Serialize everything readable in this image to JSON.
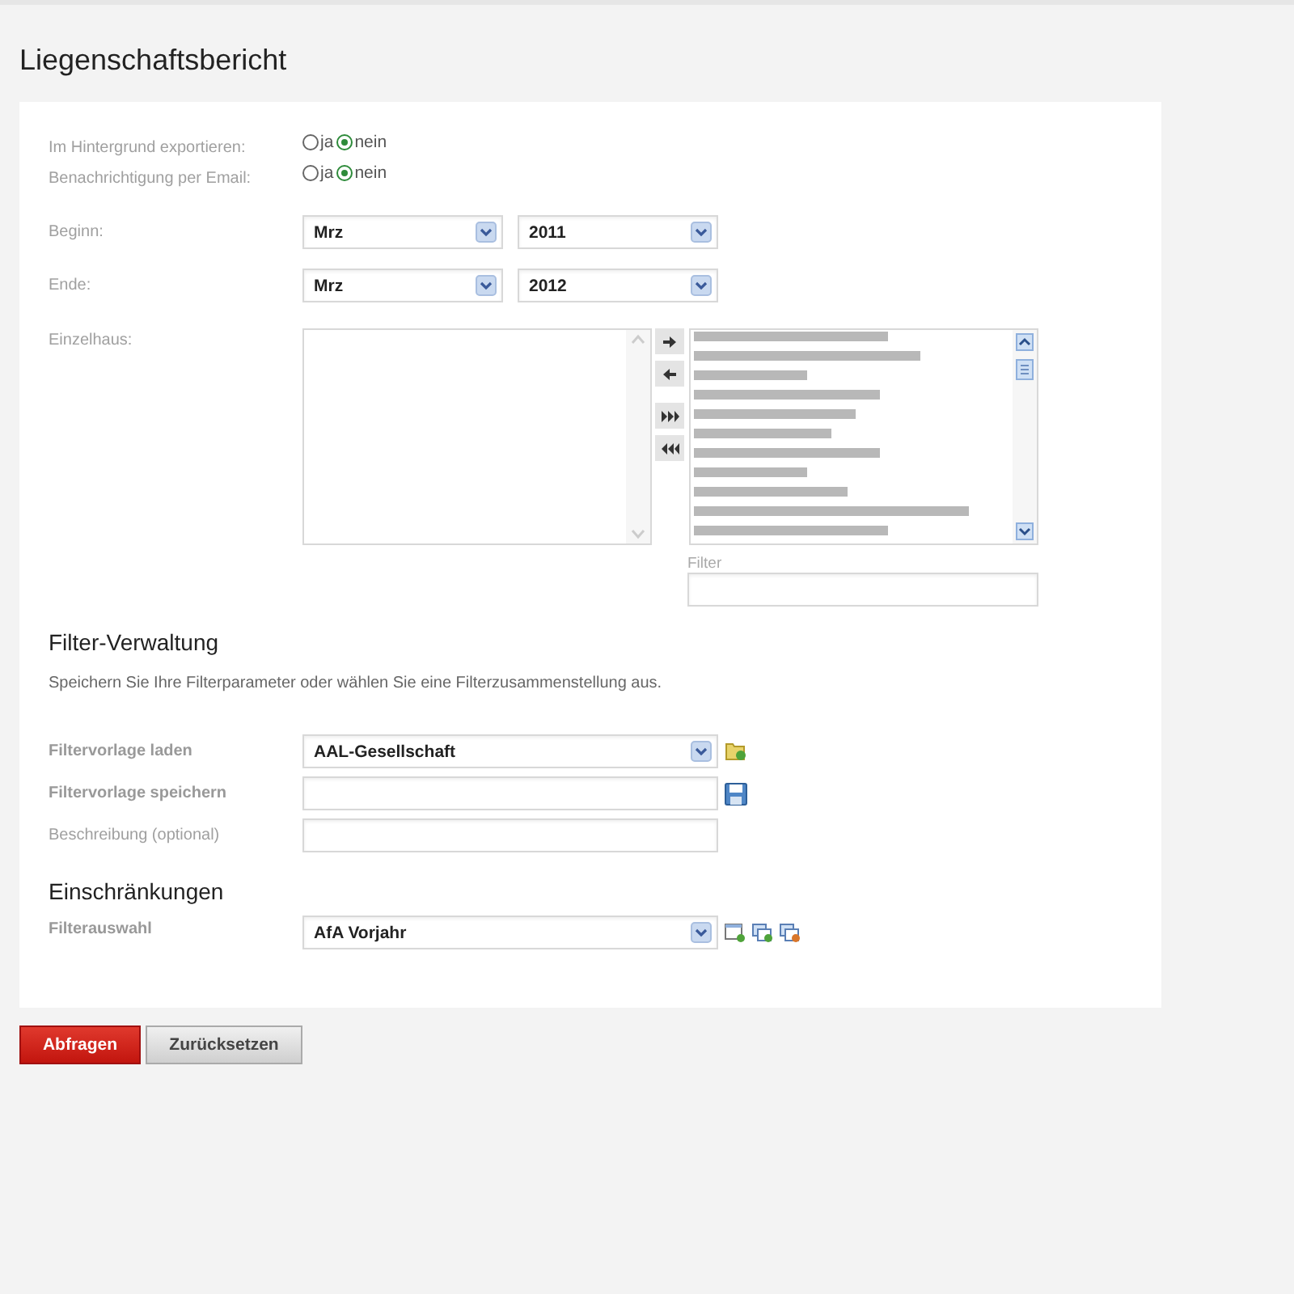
{
  "title": "Liegenschaftsbericht",
  "options": [
    {
      "label": "Im Hintergrund exportieren:",
      "choices": [
        {
          "label": "ja",
          "selected": false
        },
        {
          "label": "nein",
          "selected": true
        }
      ]
    },
    {
      "label": "Benachrichtigung per Email:",
      "choices": [
        {
          "label": "ja",
          "selected": false
        },
        {
          "label": "nein",
          "selected": true
        }
      ]
    }
  ],
  "period": [
    {
      "label": "Beginn:",
      "month": "Mrz",
      "year": "2011"
    },
    {
      "label": "Ende:",
      "month": "Mrz",
      "year": "2012"
    }
  ],
  "picker": {
    "label": "Einzelhaus:",
    "filter_label": "Filter"
  },
  "filter_management": {
    "heading": "Filter-Verwaltung",
    "description": "Speichern Sie Ihre Filterparameter oder wählen Sie eine Filterzusammenstellung aus.",
    "rows": [
      {
        "kind": "select",
        "label": "Filtervorlage laden",
        "value": "AAL-Gesellschaft"
      },
      {
        "kind": "save",
        "label": "Filtervorlage speichern"
      },
      {
        "kind": "text",
        "label": "Beschreibung (optional)"
      }
    ]
  },
  "restrictions": {
    "heading": "Einschränkungen",
    "label": "Filterauswahl",
    "value": "AfA Vorjahr"
  },
  "buttons": [
    {
      "kind": "primary",
      "label": "Abfragen"
    },
    {
      "kind": "secondary",
      "label": "Zurücksetzen"
    }
  ]
}
